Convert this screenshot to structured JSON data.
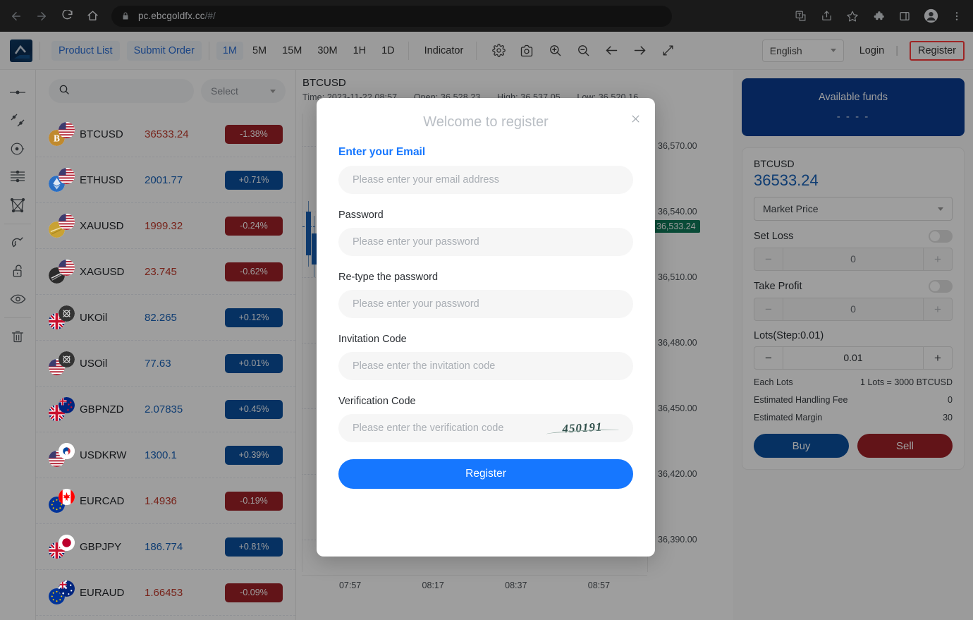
{
  "browser": {
    "url_main": "pc.ebcgoldfx.cc",
    "url_dim": "/#/",
    "back_icon": "back-arrow-icon",
    "forward_icon": "forward-arrow-icon",
    "reload_icon": "reload-icon",
    "home_icon": "home-icon",
    "lock_icon": "lock-icon",
    "right_icons": [
      "translate-icon",
      "share-icon",
      "bookmark-star-icon",
      "extensions-puzzle-icon",
      "sidepanel-icon",
      "profile-avatar-icon",
      "more-menu-icon"
    ]
  },
  "toolbar": {
    "product_list": "Product List",
    "submit_order": "Submit Order",
    "timeframes": [
      {
        "label": "1M",
        "active": true
      },
      {
        "label": "5M",
        "active": false
      },
      {
        "label": "15M",
        "active": false
      },
      {
        "label": "30M",
        "active": false
      },
      {
        "label": "1H",
        "active": false
      },
      {
        "label": "1D",
        "active": false
      }
    ],
    "indicator": "Indicator",
    "icons": [
      "gear-icon",
      "camera-icon",
      "zoom-in-icon",
      "zoom-out-icon",
      "arrow-left-icon",
      "arrow-right-icon",
      "fullscreen-icon"
    ],
    "language": "English",
    "login": "Login",
    "divider": "|",
    "register": "Register",
    "register_highlight_color": "#ff3b3b"
  },
  "tool_rail": {
    "items": [
      {
        "name": "trend-line-tool-icon"
      },
      {
        "name": "parallel-channel-tool-icon"
      },
      {
        "name": "circle-tool-icon"
      },
      {
        "name": "horizontal-lines-tool-icon"
      },
      {
        "name": "shape-tool-icon"
      },
      {
        "name": "magnet-tool-icon"
      },
      {
        "name": "unlock-tool-icon"
      },
      {
        "name": "visibility-eye-tool-icon"
      },
      {
        "name": "trash-tool-icon"
      }
    ]
  },
  "product_panel": {
    "search_placeholder": "",
    "search_value": "",
    "select_label": "Select",
    "columns": [
      "symbol",
      "price",
      "change"
    ],
    "rows": [
      {
        "symbol": "BTCUSD",
        "price": "36533.24",
        "change": "-1.38%",
        "dir": "down",
        "flag_a": "us",
        "flag_b": "btc"
      },
      {
        "symbol": "ETHUSD",
        "price": "2001.77",
        "change": "+0.71%",
        "dir": "up",
        "flag_a": "us",
        "flag_b": "eth"
      },
      {
        "symbol": "XAUUSD",
        "price": "1999.32",
        "change": "-0.24%",
        "dir": "down",
        "flag_a": "us",
        "flag_b": "gold"
      },
      {
        "symbol": "XAGUSD",
        "price": "23.745",
        "change": "-0.62%",
        "dir": "down",
        "flag_a": "us",
        "flag_b": "silver"
      },
      {
        "symbol": "UKOil",
        "price": "82.265",
        "change": "+0.12%",
        "dir": "up",
        "flag_a": "oil",
        "flag_b": "gb"
      },
      {
        "symbol": "USOil",
        "price": "77.63",
        "change": "+0.01%",
        "dir": "up",
        "flag_a": "oil",
        "flag_b": "us"
      },
      {
        "symbol": "GBPNZD",
        "price": "2.07835",
        "change": "+0.45%",
        "dir": "up",
        "flag_a": "nz",
        "flag_b": "gb"
      },
      {
        "symbol": "USDKRW",
        "price": "1300.1",
        "change": "+0.39%",
        "dir": "up",
        "flag_a": "kr",
        "flag_b": "us"
      },
      {
        "symbol": "EURCAD",
        "price": "1.4936",
        "change": "-0.19%",
        "dir": "down",
        "flag_a": "ca",
        "flag_b": "eu"
      },
      {
        "symbol": "GBPJPY",
        "price": "186.774",
        "change": "+0.81%",
        "dir": "up",
        "flag_a": "jp",
        "flag_b": "gb"
      },
      {
        "symbol": "EURAUD",
        "price": "1.66453",
        "change": "-0.09%",
        "dir": "down",
        "flag_a": "au",
        "flag_b": "eu"
      }
    ]
  },
  "chart_data": {
    "type": "line",
    "title": "BTCUSD",
    "symbol": "BTCUSD",
    "time_label": "Time: 2023-11-22 08:57",
    "open_label": "Open: 36,528.23",
    "high_label": "High: 36,537.05",
    "low_label": "Low: 36,520.16",
    "time": "2023-11-22 08:57",
    "open": 36528.23,
    "high": 36537.05,
    "low": 36520.16,
    "current_price": "36,533.24",
    "current_price_value": 36533.24,
    "current_price_badge_color": "#0f7a5a",
    "y_ticks": [
      "36,570.00",
      "36,540.00",
      "36,510.00",
      "36,480.00",
      "36,450.00",
      "36,420.00",
      "36,390.00"
    ],
    "y_values": [
      36570,
      36540,
      36510,
      36480,
      36450,
      36420,
      36390
    ],
    "ylim": [
      36375,
      36585
    ],
    "x_ticks": [
      "07:57",
      "08:17",
      "08:37",
      "08:57"
    ],
    "xlabel": "",
    "ylabel": "",
    "grid": true,
    "legend": "none"
  },
  "trade_panel": {
    "funds_title": "Available funds",
    "funds_value": "- - - -",
    "symbol": "BTCUSD",
    "price": "36533.24",
    "order_type": "Market Price",
    "set_loss_label": "Set Loss",
    "set_loss_value": "0",
    "set_loss_enabled": false,
    "take_profit_label": "Take Profit",
    "take_profit_value": "0",
    "take_profit_enabled": false,
    "lots_label": "Lots(Step:0.01)",
    "lots_value": "0.01",
    "minus": "−",
    "plus": "+",
    "info": [
      {
        "label": "Each Lots",
        "value": "1 Lots = 3000 BTCUSD"
      },
      {
        "label": "Estimated Handling Fee",
        "value": "0"
      },
      {
        "label": "Estimated Margin",
        "value": "30"
      }
    ],
    "buy": "Buy",
    "sell": "Sell",
    "buy_color": "#0b4f9e",
    "sell_color": "#9e2128"
  },
  "modal": {
    "title": "Welcome to register",
    "close_icon": "close-icon",
    "email_label": "Enter your Email",
    "email_placeholder": "Please enter your email address",
    "email_value": "",
    "password_label": "Password",
    "password_placeholder": "Please enter your password",
    "password_value": "",
    "retype_label": "Re-type the password",
    "retype_placeholder": "Please enter your password",
    "retype_value": "",
    "invitation_label": "Invitation Code",
    "invitation_placeholder": "Please enter the invitation code",
    "invitation_value": "",
    "verification_label": "Verification Code",
    "verification_placeholder": "Please enter the verification code",
    "verification_value": "",
    "captcha_text": "450191",
    "submit": "Register",
    "submit_color": "#1677ff"
  }
}
